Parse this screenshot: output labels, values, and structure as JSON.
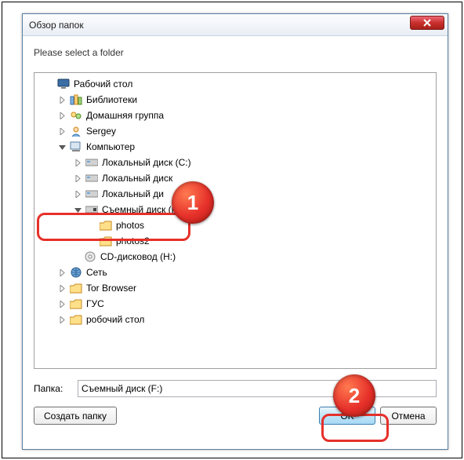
{
  "window": {
    "title": "Обзор папок",
    "instruction": "Please select a folder"
  },
  "tree": {
    "desktop": "Рабочий стол",
    "libraries": "Библиотеки",
    "homegroup": "Домашняя группа",
    "user": "Sergey",
    "computer": "Компьютер",
    "drive_c": "Локальный диск (C:)",
    "drive_d": "Локальный диск",
    "drive_e": "Локальный ди",
    "remov_f": "Съемный диск (F",
    "photos": "photos",
    "photos2": "photos2",
    "cd_h": "CD-дисковод (H:)",
    "network": "Сеть",
    "tor": "Tor Browser",
    "gus": "ГУС",
    "desk2": "робочий стол"
  },
  "footer": {
    "path_label": "Папка:",
    "path_value": "Съемный диск (F:)",
    "new_folder": "Создать папку",
    "ok": "OK",
    "cancel": "Отмена"
  },
  "annotations": {
    "badge1": "1",
    "badge2": "2"
  }
}
